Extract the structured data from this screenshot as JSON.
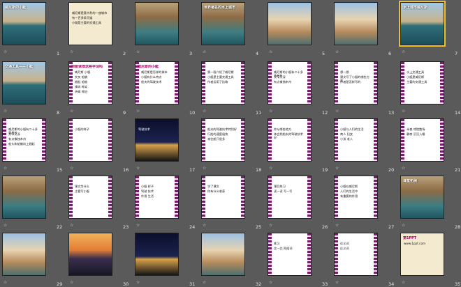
{
  "sorter": {
    "slides": [
      {
        "n": "1",
        "kind": "photo-sea",
        "title": "威尼斯的小艇",
        "has_star": true,
        "selected": false
      },
      {
        "n": "2",
        "kind": "text",
        "title": "",
        "lines": [
          "威尼斯是意大利的一座城市",
          "有一百多条河道",
          "小艇是主要的交通工具"
        ],
        "has_star": true,
        "selected": false
      },
      {
        "n": "3",
        "kind": "photo-canal",
        "title": "",
        "has_star": true,
        "selected": false
      },
      {
        "n": "4",
        "kind": "photo-canal",
        "title": "世界著名的水上城市",
        "has_star": true,
        "selected": false
      },
      {
        "n": "5",
        "kind": "photo-city",
        "title": "",
        "has_star": true,
        "selected": false
      },
      {
        "n": "6",
        "kind": "photo-city",
        "title": "",
        "has_star": true,
        "selected": false
      },
      {
        "n": "7",
        "kind": "photo-sea",
        "title": "水上城市威尼斯",
        "has_star": true,
        "selected": true
      },
      {
        "n": "8",
        "kind": "photo-sea",
        "title": "交通工具——小艇",
        "has_star": true,
        "selected": false
      },
      {
        "n": "9",
        "kind": "frame",
        "title": "你能读准这些字词吗",
        "lines": [
          "威尼斯 小艇",
          "交叉 船艄",
          "翘起 船舱",
          "操纵 哗笑",
          "祈祷 停泊"
        ],
        "has_star": true,
        "selected": false
      },
      {
        "n": "10",
        "kind": "frame",
        "title": "威尼斯的小艇",
        "lines": [
          "威尼斯是怎样的城市",
          "小艇有什么特点",
          "船夫的驾驶技术"
        ],
        "has_star": true,
        "selected": false
      },
      {
        "n": "11",
        "kind": "frame",
        "title": "",
        "lines": [
          "第一段介绍了威尼斯",
          "小艇是主要交通工具",
          "作者运用了比喻"
        ],
        "has_star": true,
        "selected": false
      },
      {
        "n": "12",
        "kind": "frame",
        "title": "",
        "lines": [
          "威尼斯的小艇有二十多英尺长",
          "又窄又深",
          "有点像独木舟"
        ],
        "has_star": true,
        "selected": false
      },
      {
        "n": "13",
        "kind": "frame",
        "title": "",
        "lines": [
          "想一想",
          "课文写了小艇的哪些方面",
          "作者是怎样写的"
        ],
        "has_star": true,
        "selected": false
      },
      {
        "n": "14",
        "kind": "frame",
        "title": "",
        "lines": [
          "水上交通工具",
          "小艇是威尼斯",
          "主要的交通工具"
        ],
        "has_star": true,
        "selected": false
      },
      {
        "n": "15",
        "kind": "frame",
        "title": "",
        "lines": [
          "威尼斯的小艇有二十多英尺长",
          "又窄又深",
          "有点像独木舟",
          "船头和船艄向上翘起"
        ],
        "has_star": true,
        "selected": false
      },
      {
        "n": "16",
        "kind": "frame",
        "title": "",
        "lines": [
          "小艇的样子"
        ],
        "has_star": true,
        "selected": false
      },
      {
        "n": "17",
        "kind": "photo-night",
        "title": "",
        "lines": [
          "驾驶技术"
        ],
        "has_star": true,
        "selected": false
      },
      {
        "n": "18",
        "kind": "frame",
        "title": "",
        "lines": [
          "船夫的驾驶技术特别好",
          "行船的速度极快",
          "来往船只很多"
        ],
        "has_star": true,
        "selected": false
      },
      {
        "n": "19",
        "kind": "frame",
        "title": "",
        "lines": [
          "你从哪些地方",
          "体会到船夫的驾驶技术好"
        ],
        "has_star": true,
        "selected": false
      },
      {
        "n": "20",
        "kind": "frame",
        "title": "",
        "lines": [
          "小艇与人们的生活",
          "商人 妇女",
          "小孩 老人"
        ],
        "has_star": true,
        "selected": false
      },
      {
        "n": "21",
        "kind": "frame",
        "title": "",
        "lines": [
          "半夜 戏院散场",
          "静寂 沉沉入睡"
        ],
        "has_star": true,
        "selected": false
      },
      {
        "n": "22",
        "kind": "photo-canal",
        "title": "",
        "has_star": true,
        "selected": false
      },
      {
        "n": "23",
        "kind": "frame",
        "title": "",
        "lines": [
          "课文为什么",
          "主要写小艇"
        ],
        "has_star": true,
        "selected": false
      },
      {
        "n": "24",
        "kind": "frame",
        "title": "",
        "lines": [
          "小艇 样子",
          "驾驶 技术",
          "作用 生活"
        ],
        "has_star": true,
        "selected": false
      },
      {
        "n": "25",
        "kind": "frame",
        "title": "",
        "lines": [
          "学了课文",
          "你有什么收获"
        ],
        "has_star": true,
        "selected": false
      },
      {
        "n": "26",
        "kind": "frame",
        "title": "",
        "lines": [
          "课后练习",
          "读一读 写一写"
        ],
        "has_star": true,
        "selected": false
      },
      {
        "n": "27",
        "kind": "frame",
        "title": "",
        "lines": [
          "小艇在威尼斯",
          "人们的生活中",
          "有重要的作用"
        ],
        "has_star": true,
        "selected": false
      },
      {
        "n": "28",
        "kind": "photo-canal",
        "title": "课堂拓展",
        "has_star": true,
        "selected": false
      },
      {
        "n": "29",
        "kind": "photo-city",
        "title": "",
        "has_star": true,
        "selected": false
      },
      {
        "n": "30",
        "kind": "photo-dusk",
        "title": "",
        "has_star": true,
        "selected": false
      },
      {
        "n": "31",
        "kind": "photo-night",
        "title": "",
        "has_star": true,
        "selected": false
      },
      {
        "n": "32",
        "kind": "photo-city",
        "title": "",
        "has_star": true,
        "selected": false
      },
      {
        "n": "33",
        "kind": "frame",
        "title": "",
        "lines": [
          "练习",
          "比一比 再组词"
        ],
        "has_star": true,
        "selected": false
      },
      {
        "n": "34",
        "kind": "frame",
        "title": "",
        "lines": [
          "近义词",
          "反义词"
        ],
        "has_star": true,
        "selected": false
      },
      {
        "n": "35",
        "kind": "textbg",
        "title": "第1PPT",
        "lines": [
          "www.1ppt.com"
        ],
        "has_star": true,
        "selected": false
      }
    ]
  }
}
